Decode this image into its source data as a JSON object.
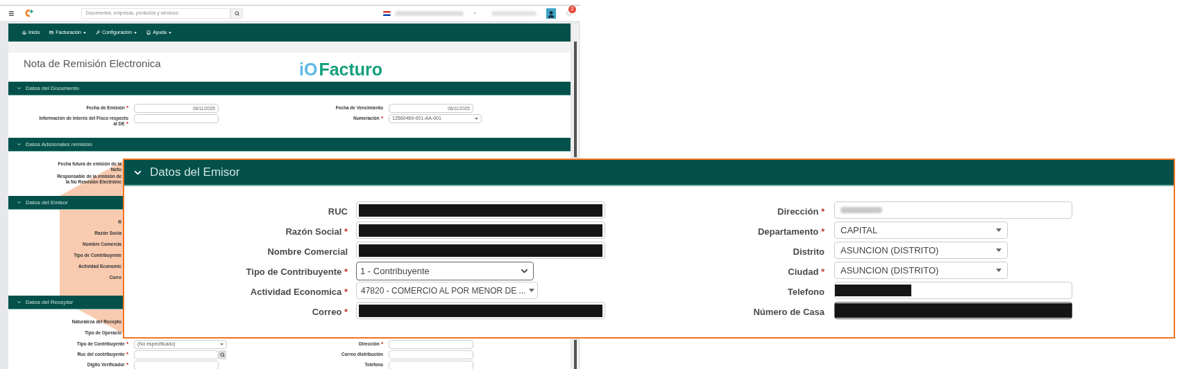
{
  "topbar": {
    "search": {
      "placeholder": "Documentos, empresas, productos y servicios"
    },
    "notifications": {
      "badge": "2"
    }
  },
  "nav": [
    {
      "label": "Inicio",
      "dropdown": false
    },
    {
      "label": "Facturación",
      "dropdown": true
    },
    {
      "label": "Configuración",
      "dropdown": true
    },
    {
      "label": "Ayuda",
      "dropdown": true
    }
  ],
  "page_title": "Nota de Remisión Electronica",
  "logo": {
    "mark": "iO",
    "name": "Facturo"
  },
  "sections": [
    {
      "title": "Datos del Documento",
      "expanded": true,
      "rows": [
        {
          "left": {
            "label": "Fecha de Emisión",
            "required": "*",
            "kind": "date",
            "value": "06/11/2025"
          },
          "right": {
            "label": "Fecha de Vencimiento",
            "kind": "date",
            "value": "06/11/2025"
          }
        },
        {
          "left": {
            "label": "Información de interés del Fisco respecto al DE",
            "required": "*",
            "kind": "text"
          },
          "right": {
            "label": "Numeración",
            "required": "*",
            "kind": "select",
            "value": "12560469-001-AA-001"
          }
        }
      ]
    },
    {
      "title": "Datos Adicionales remisión",
      "expanded": true,
      "rows": [
        {
          "left": {
            "label": "Fecha futura de emisión de la factu",
            "kind": "cut"
          }
        },
        {
          "left": {
            "label": "Responsable de la emisión de la No Remisión Electrónic",
            "kind": "cut"
          }
        }
      ]
    },
    {
      "title": "Datos del Emisor",
      "expanded": true,
      "rows": [
        {
          "left": {
            "label": "R",
            "kind": "cut"
          }
        },
        {
          "left": {
            "label": "Razón Socia",
            "kind": "cut"
          }
        },
        {
          "left": {
            "label": "Nombre Comercia",
            "kind": "cut"
          }
        },
        {
          "left": {
            "label": "Tipo de Contribuyente",
            "kind": "cut"
          }
        },
        {
          "left": {
            "label": "Actividad Economic",
            "kind": "cut"
          }
        },
        {
          "left": {
            "label": "Corre",
            "kind": "cut"
          }
        }
      ]
    },
    {
      "title": "Datos del Receptor",
      "expanded": true,
      "rows": [
        {
          "left": {
            "label": "Naturaleza del Recepto",
            "kind": "cut"
          }
        },
        {
          "left": {
            "label": "Tipo de Operacio",
            "kind": "cut"
          }
        },
        {
          "left": {
            "label": "Tipo de Contribuyente",
            "required": "*",
            "kind": "select",
            "value": "(No especificado)"
          },
          "right": {
            "label": "Dirección",
            "required": "*",
            "kind": "text"
          }
        },
        {
          "left": {
            "label": "Ruc del contribuyente",
            "required": "*",
            "kind": "search"
          },
          "right": {
            "label": "Correo distribución",
            "kind": "text"
          }
        },
        {
          "left": {
            "label": "Digito Verificador",
            "required": "*",
            "kind": "text"
          },
          "right": {
            "label": "Teléfono",
            "kind": "text"
          }
        }
      ]
    }
  ],
  "callout": {
    "title": "Datos del Emisor",
    "expanded": true,
    "left": [
      {
        "label": "RUC",
        "kind": "redacted"
      },
      {
        "label": "Razón Social",
        "required": "*",
        "kind": "redacted"
      },
      {
        "label": "Nombre Comercial",
        "kind": "redacted"
      },
      {
        "label": "Tipo de Contribuyente",
        "required": "*",
        "kind": "select-native",
        "value": "1 - Contribuyente"
      },
      {
        "label": "Actividad Economica",
        "required": "*",
        "kind": "select",
        "value": "47820 - COMERCIO AL POR MENOR DE ..."
      },
      {
        "label": "Correo",
        "required": "*",
        "kind": "redacted"
      }
    ],
    "right": [
      {
        "label": "Dirección",
        "required": "*",
        "kind": "blurred"
      },
      {
        "label": "Departamento",
        "required": "*",
        "kind": "select",
        "value": "CAPITAL"
      },
      {
        "label": "Distrito",
        "kind": "select",
        "value": "ASUNCION (DISTRITO)"
      },
      {
        "label": "Ciudad",
        "required": "*",
        "kind": "select",
        "value": "ASUNCION (DISTRITO)"
      },
      {
        "label": "Telefono",
        "kind": "redacted-short"
      },
      {
        "label": "Número de Casa",
        "kind": "redacted-long"
      }
    ]
  }
}
